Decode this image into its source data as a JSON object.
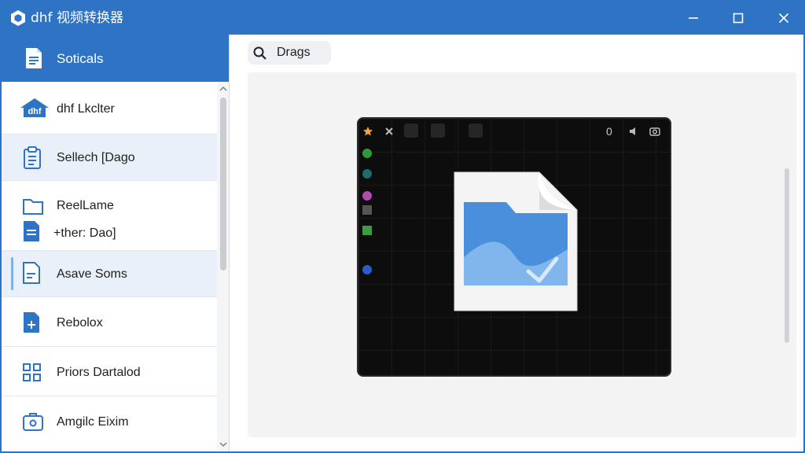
{
  "app": {
    "title": "dhf 视频转换器"
  },
  "sidebar": {
    "header": {
      "label": "Soticals",
      "icon": "document-icon"
    },
    "items": [
      {
        "label": "dhf Lkclter",
        "icon": "dhf-logo-icon"
      },
      {
        "label": "Sellech [Dago",
        "icon": "clipboard-list-icon",
        "selected": true
      },
      {
        "label": "ReelLame",
        "icon": "folder-icon"
      },
      {
        "label": "+ther: Dao]",
        "icon": "document-lines-icon"
      },
      {
        "label": "Asave Soms",
        "icon": "document-edit-icon",
        "selected": true
      },
      {
        "label": "Rebolox",
        "icon": "document-plus-icon"
      },
      {
        "label": "Priors Dartalod",
        "icon": "grid-icon"
      },
      {
        "label": "Amgilc Eixim",
        "icon": "briefcase-icon"
      }
    ]
  },
  "main": {
    "search": {
      "label": "Drags",
      "icon": "search-icon"
    },
    "preview": {
      "toolbar_right": "0"
    }
  },
  "colors": {
    "accent": "#2f73c5",
    "selected_bg": "#e9f0f9",
    "panel_bg": "#f3f3f3",
    "preview_bg": "#0d0d0d"
  }
}
